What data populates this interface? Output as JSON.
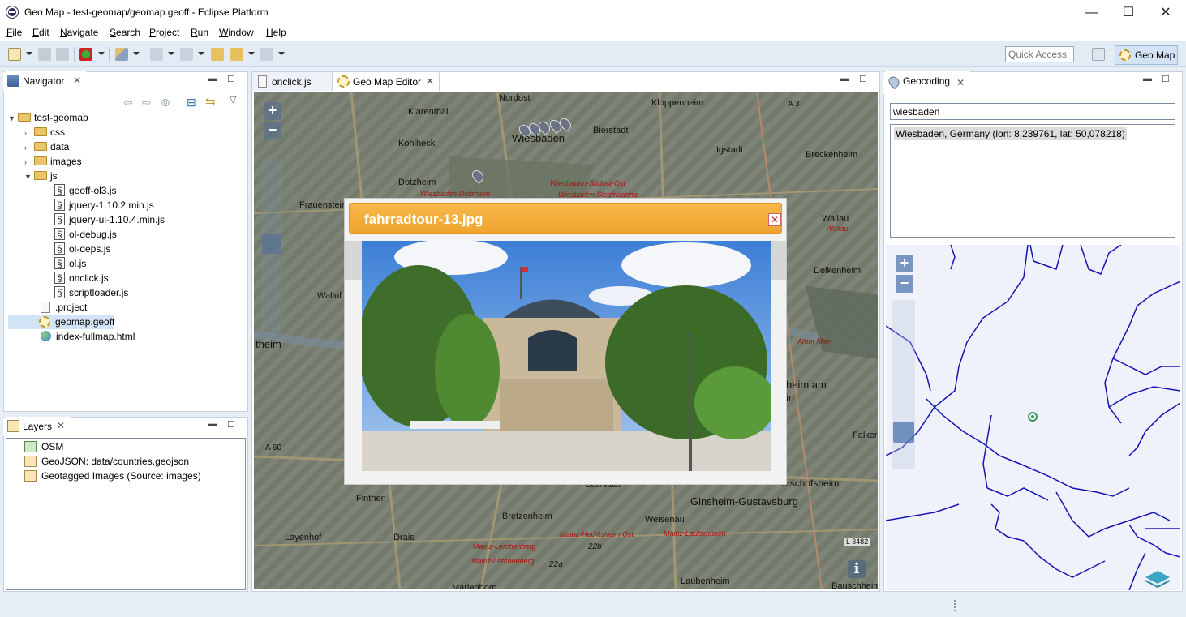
{
  "window": {
    "title": "Geo Map - test-geomap/geomap.geoff - Eclipse Platform",
    "minimize": "—",
    "maximize": "☐",
    "close": "✕"
  },
  "menu": [
    "File",
    "Edit",
    "Navigate",
    "Search",
    "Project",
    "Run",
    "Window",
    "Help"
  ],
  "toolbar": {
    "quick_access_placeholder": "Quick Access",
    "perspective": "Geo Map"
  },
  "navigator": {
    "tab_label": "Navigator",
    "project": "test-geomap",
    "folders": [
      "css",
      "data",
      "images",
      "js"
    ],
    "js_files": [
      "geoff-ol3.js",
      "jquery-1.10.2.min.js",
      "jquery-ui-1.10.4.min.js",
      "ol-debug.js",
      "ol-deps.js",
      "ol.js",
      "onclick.js",
      "scriptloader.js"
    ],
    "root_files": [
      ".project",
      "geomap.geoff",
      "index-fullmap.html"
    ]
  },
  "layers": {
    "tab_label": "Layers",
    "items": [
      "OSM",
      "GeoJSON: data/countries.geojson",
      "Geotagged Images (Source: images)"
    ]
  },
  "editor": {
    "tabs": [
      "onclick.js",
      "Geo Map Editor"
    ],
    "map_labels": [
      "Nordost",
      "Klarenthal",
      "Kloppenheim",
      "A 3",
      "Bierstadt",
      "Kohlheck",
      "Wiesbaden",
      "Igstadt",
      "Breckenheim",
      "Dotzheim",
      "Wiesbaden-Südost-Ost",
      "Wiesbaden-Dotzheim",
      "Wiesbaden Siegfriedring",
      "Frauenstein",
      "Wallau",
      "Wallau",
      "Walluf",
      "Delkenheim",
      "theim",
      "Amm Main",
      "heim am",
      "in",
      "A 60",
      "Falker",
      "Oberstadt",
      "Bischofsheim",
      "Ginsheim-Gustavsburg",
      "Finthen",
      "Bretzenheim",
      "Weisenau",
      "Layenhof",
      "Drais",
      "Mainz-Hechtsheim Ost",
      "Mainz-Laubenheim",
      "Mainz-Lerchenberg",
      "22b",
      "Mainz-Lerchenberg",
      "22a",
      "L 3482",
      "Marienborn",
      "Laubenheim",
      "Bauschheim"
    ],
    "popup_title": "fahrradtour-13.jpg",
    "info_button": "i",
    "zoom_in": "+",
    "zoom_out": "−"
  },
  "geocoding": {
    "tab_label": "Geocoding",
    "query": "wiesbaden",
    "result": "Wiesbaden, Germany (lon: 8,239761, lat: 50,078218)",
    "zoom_in": "+",
    "zoom_out": "−"
  },
  "colors": {
    "accent": "#f0a42f",
    "border_lines": "#1414b4",
    "selection": "#d2e3f5"
  }
}
